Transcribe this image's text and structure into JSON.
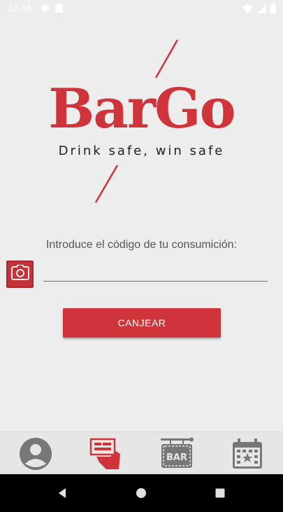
{
  "status_bar": {
    "time": "10:46",
    "left_icons": [
      "gear-icon",
      "sd-card-icon"
    ],
    "right_icons": [
      "wifi-icon",
      "signal-icon",
      "battery-icon"
    ]
  },
  "logo": {
    "brand": "BarGo",
    "tagline": "Drink safe, win safe"
  },
  "form": {
    "prompt": "Introduce el código de tu consumición:",
    "code_value": "",
    "code_placeholder": "",
    "camera_icon": "camera-icon",
    "redeem_label": "CANJEAR"
  },
  "bottom_nav": {
    "items": [
      {
        "name": "profile",
        "icon": "person-icon"
      },
      {
        "name": "redeem-ticket",
        "icon": "ticket-hand-icon",
        "active": true
      },
      {
        "name": "bars",
        "icon": "bar-sign-icon"
      },
      {
        "name": "events",
        "icon": "calendar-star-icon"
      }
    ]
  },
  "system_nav": {
    "items": [
      "back-icon",
      "home-icon",
      "recents-icon"
    ]
  },
  "colors": {
    "accent": "#d0343b",
    "background": "#ededed",
    "nav_icon": "#777777"
  }
}
